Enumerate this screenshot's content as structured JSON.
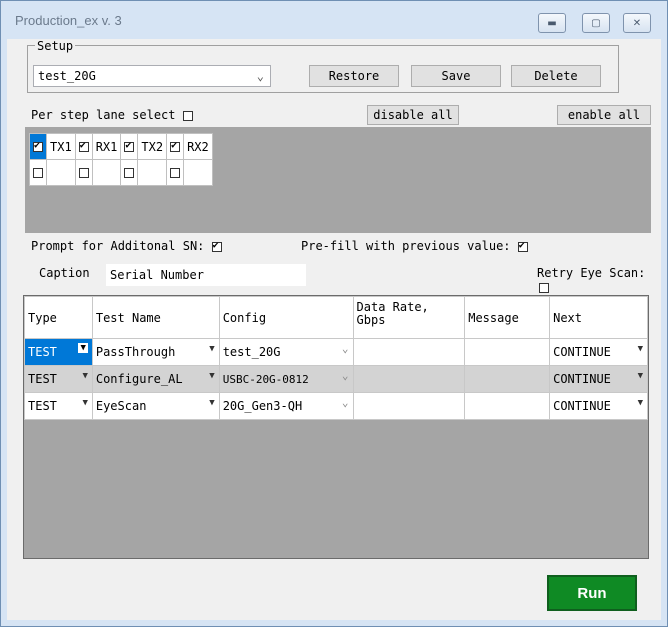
{
  "window": {
    "title": "Production_ex v. 3",
    "minimize_icon": "minimize-icon",
    "maximize_icon": "maximize-icon",
    "close_icon": "close-icon"
  },
  "setup": {
    "label": "Setup",
    "selected": "test_20G",
    "restore_label": "Restore",
    "save_label": "Save",
    "delete_label": "Delete"
  },
  "per_step_lane_select": {
    "label": "Per step lane select",
    "checked": false
  },
  "disable_all_label": "disable all",
  "enable_all_label": "enable all",
  "lanes": {
    "row1": [
      {
        "label": "TX1",
        "checked": true
      },
      {
        "label": "RX1",
        "checked": true
      },
      {
        "label": "TX2",
        "checked": true
      },
      {
        "label": "RX2",
        "checked": true
      }
    ],
    "row2": [
      {
        "label": "",
        "checked": false
      },
      {
        "label": "",
        "checked": false
      },
      {
        "label": "",
        "checked": false
      },
      {
        "label": "",
        "checked": false
      }
    ]
  },
  "prompt_sn": {
    "label": "Prompt for Additonal SN:",
    "checked": true
  },
  "prefill": {
    "label": "Pre-fill with previous value:",
    "checked": true
  },
  "caption": {
    "label": "Caption",
    "value": "Serial Number"
  },
  "retry_eye_scan": {
    "label": "Retry Eye Scan:"
  },
  "table": {
    "headers": [
      "Type",
      "Test Name",
      "Config",
      "Data Rate,\nGbps",
      "Message",
      "Next"
    ],
    "rows": [
      {
        "type": "TEST",
        "name": "PassThrough",
        "config": "test_20G",
        "rate": "",
        "message": "",
        "next": "CONTINUE"
      },
      {
        "type": "TEST",
        "name": "Configure_AL",
        "config": "USBC-20G-0812",
        "rate": "",
        "message": "",
        "next": "CONTINUE"
      },
      {
        "type": "TEST",
        "name": "EyeScan",
        "config": "20G_Gen3-QH",
        "rate": "",
        "message": "",
        "next": "CONTINUE"
      }
    ]
  },
  "run_label": "Run",
  "colors": {
    "run_button": "#0f8a24",
    "selection": "#0078d7",
    "grid_background": "#a5a5a5"
  }
}
